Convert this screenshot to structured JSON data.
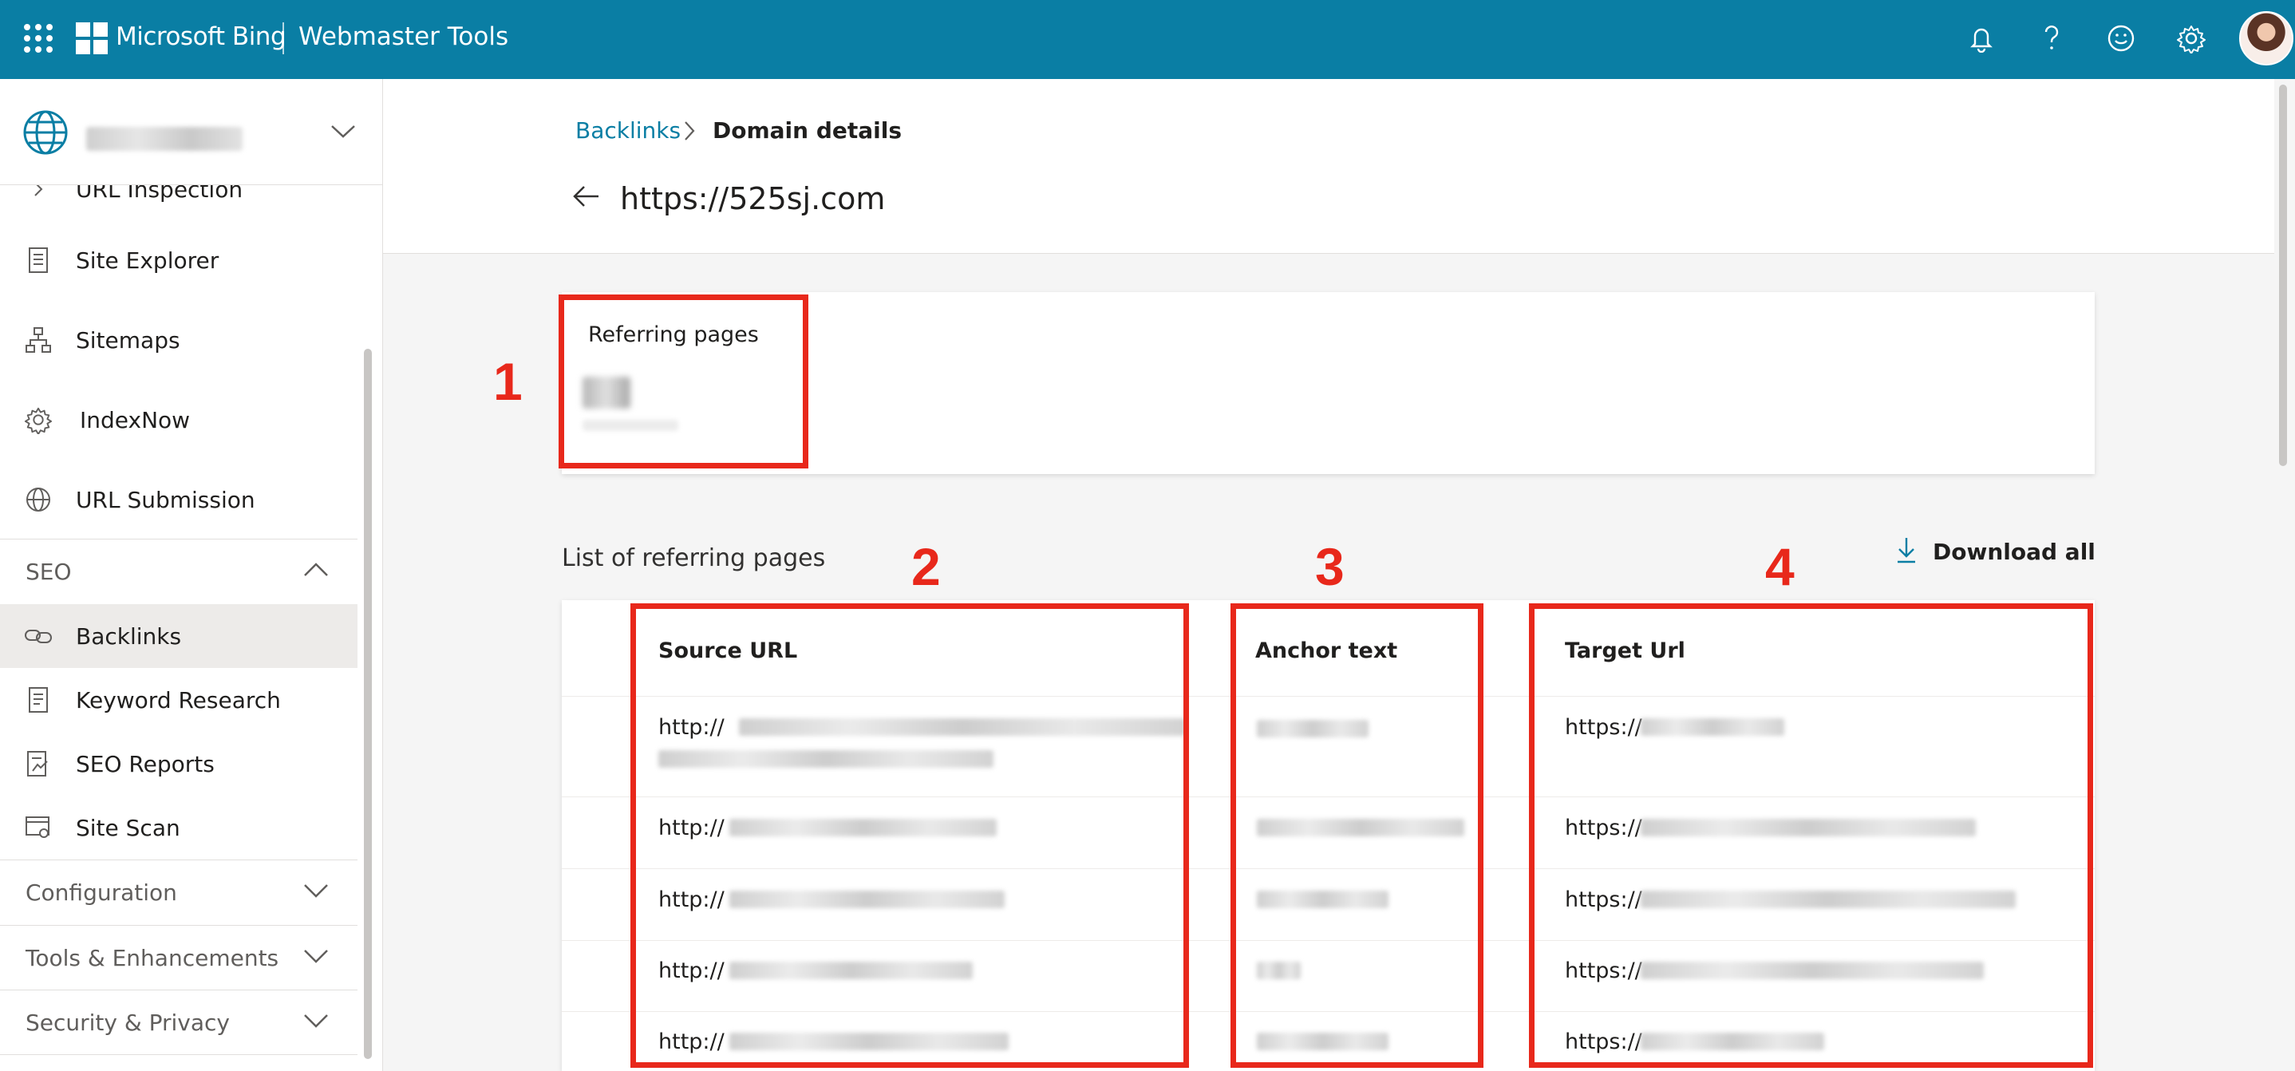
{
  "topbar": {
    "brand": "Microsoft Bing",
    "product": "Webmaster Tools",
    "icons": [
      "apps-icon",
      "bell-icon",
      "help-icon",
      "feedback-smiley-icon",
      "settings-gear-icon",
      "user-avatar"
    ],
    "color": "#0a7ea4"
  },
  "sidebar": {
    "partial_item": "URL Inspection",
    "items": [
      {
        "label": "Site Explorer",
        "icon": "site-explorer-icon"
      },
      {
        "label": "Sitemaps",
        "icon": "sitemap-icon"
      },
      {
        "label": "IndexNow",
        "icon": "gear-icon"
      },
      {
        "label": "URL Submission",
        "icon": "globe-icon"
      }
    ],
    "seo_section": "SEO",
    "seo_items": [
      {
        "label": "Backlinks",
        "icon": "link-icon",
        "active": true
      },
      {
        "label": "Keyword Research",
        "icon": "document-icon"
      },
      {
        "label": "SEO Reports",
        "icon": "report-icon"
      },
      {
        "label": "Site Scan",
        "icon": "site-scan-icon"
      }
    ],
    "sections": [
      "Configuration",
      "Tools & Enhancements",
      "Security & Privacy"
    ]
  },
  "breadcrumb": {
    "link": "Backlinks",
    "current": "Domain details"
  },
  "page_title": "https://525sj.com",
  "summary": {
    "label": "Referring pages"
  },
  "list": {
    "title": "List of referring pages",
    "download_label": "Download all",
    "columns": [
      "Source URL",
      "Anchor text",
      "Target Url"
    ],
    "rows": [
      {
        "source": "http://",
        "target": "https://"
      },
      {
        "source": "http://",
        "target": "https://"
      },
      {
        "source": "http://",
        "target": "https://"
      },
      {
        "source": "http://",
        "target": "https://"
      },
      {
        "source": "http://",
        "target": "https://"
      }
    ]
  },
  "annotations": [
    "1",
    "2",
    "3",
    "4"
  ],
  "annotation_color": "#e8281b"
}
